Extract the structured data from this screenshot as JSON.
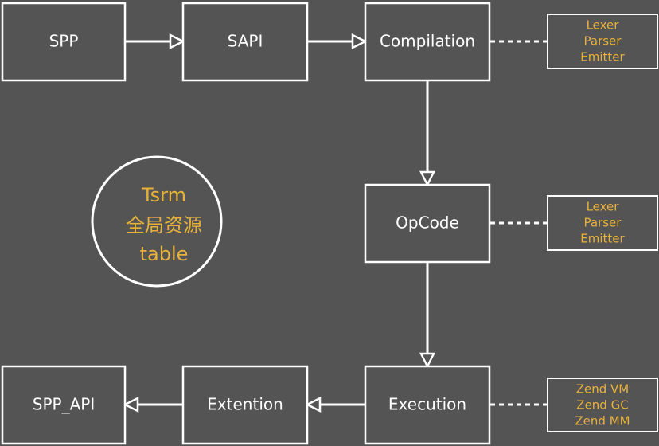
{
  "colors": {
    "background": "#545454",
    "stroke": "#ffffff",
    "accent_text": "#e8b23a"
  },
  "nodes": {
    "spp": "SPP",
    "sapi": "SAPI",
    "compilation": "Compilation",
    "opcode": "OpCode",
    "execution": "Execution",
    "extention": "Extention",
    "spp_api": "SPP_API"
  },
  "side_notes": {
    "compilation": [
      "Lexer",
      "Parser",
      "Emitter"
    ],
    "opcode": [
      "Lexer",
      "Parser",
      "Emitter"
    ],
    "execution": [
      "Zend VM",
      "Zend GC",
      "Zend MM"
    ]
  },
  "circle": {
    "lines": [
      "Tsrm",
      "全局资源",
      "table"
    ]
  }
}
